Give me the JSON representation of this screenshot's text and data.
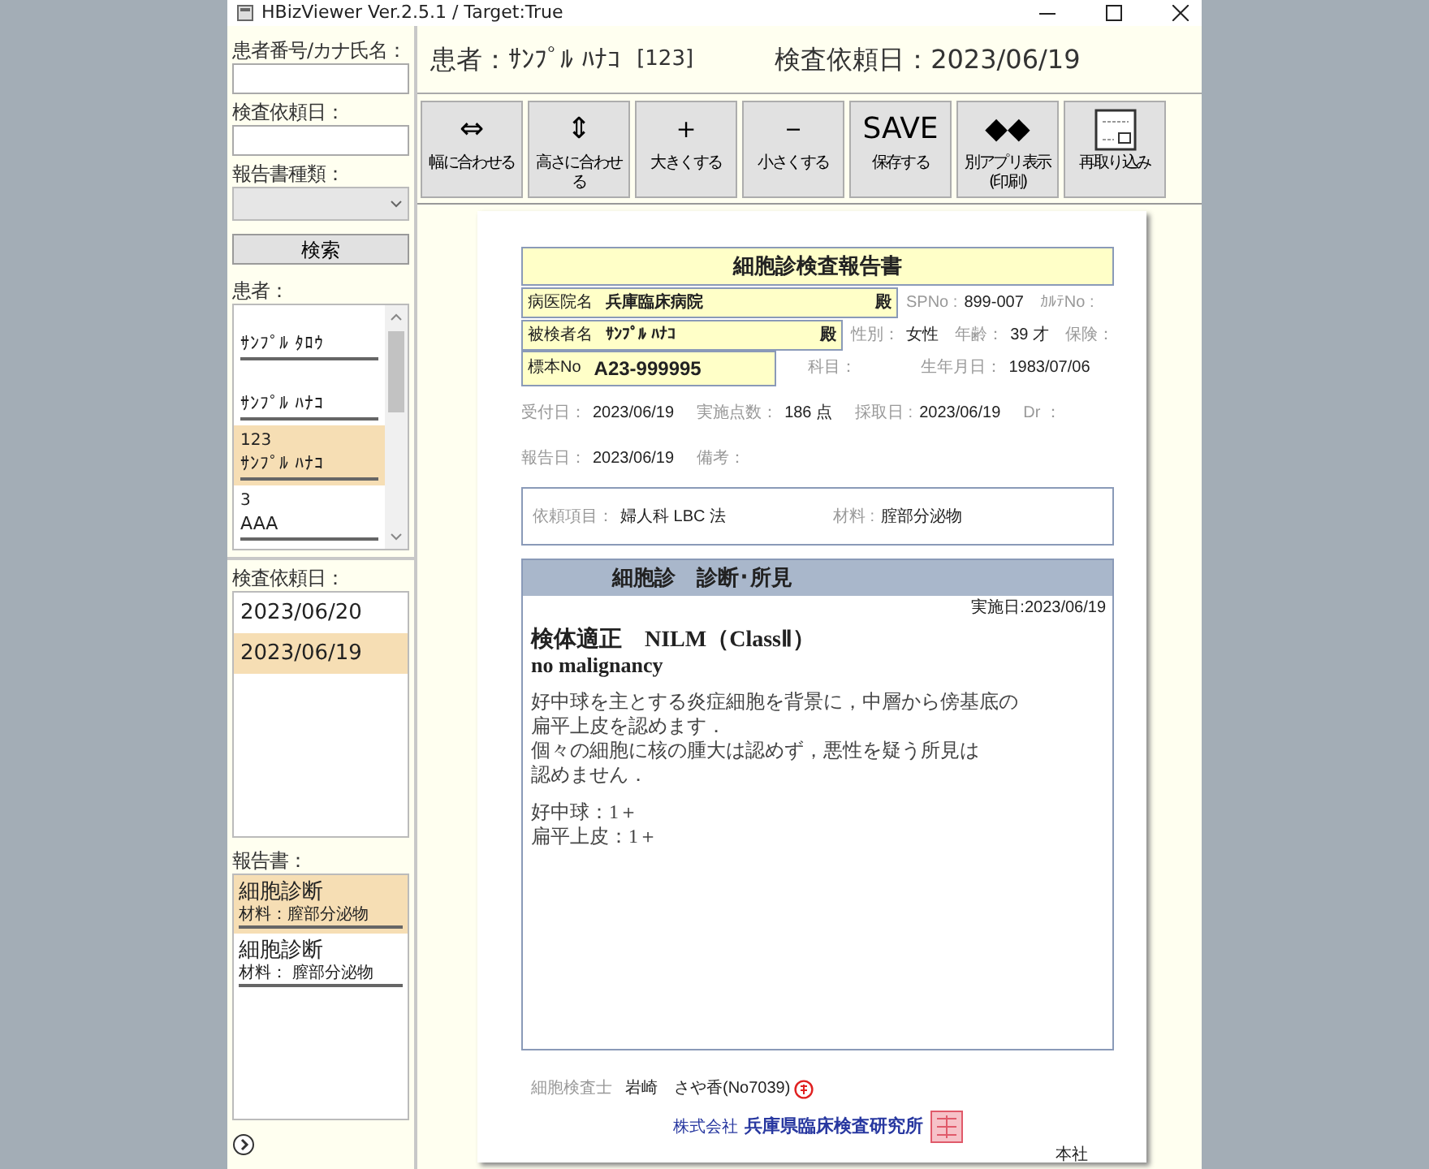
{
  "window": {
    "title": "HBizViewer Ver.2.5.1 / Target:True"
  },
  "sidebar": {
    "filters": [
      {
        "label": "患者番号/カナ氏名：",
        "kind": "text"
      },
      {
        "label": "検査依頼日：",
        "kind": "text"
      },
      {
        "label": "報告書種類：",
        "kind": "select"
      }
    ],
    "search_button": "検索",
    "patients": {
      "label": "患者：",
      "items": [
        {
          "name": "ｻﾝﾌﾟﾙ ﾀﾛｳ",
          "selected": false
        },
        {
          "name": "ｻﾝﾌﾟﾙ ﾊﾅｺ",
          "selected": false
        },
        {
          "id": "123",
          "name": "ｻﾝﾌﾟﾙ ﾊﾅｺ",
          "selected": true
        },
        {
          "id": "3",
          "name": "AAA",
          "selected": false
        }
      ]
    },
    "dates": {
      "label": "検査依頼日：",
      "items": [
        {
          "date": "2023/06/20",
          "selected": false
        },
        {
          "date": "2023/06/19",
          "selected": true
        }
      ]
    },
    "reports": {
      "label": "報告書：",
      "items": [
        {
          "title": "細胞診断",
          "material": "材料：膣部分泌物",
          "selected": true
        },
        {
          "title": "細胞診断",
          "material": "材料： 膣部分泌物",
          "selected": false
        }
      ]
    }
  },
  "header": {
    "patient": "患者：ｻﾝﾌﾟﾙ ﾊﾅｺ",
    "patient_id": "[123]",
    "request_date": "検査依頼日：2023/06/19"
  },
  "toolbar": [
    {
      "kind": "glyph",
      "glyph": "⇔",
      "label": "幅に合わせる"
    },
    {
      "kind": "glyph",
      "glyph": "⇕",
      "label": "高さに合わせる"
    },
    {
      "kind": "glyph",
      "glyph": "＋",
      "label": "大きくする"
    },
    {
      "kind": "glyph",
      "glyph": "－",
      "label": "小さくする"
    },
    {
      "kind": "glyph",
      "glyph": "SAVE",
      "label": "保存する"
    },
    {
      "kind": "glyph",
      "glyph": "◆◆",
      "label": "別アプリ表示\n(印刷)"
    },
    {
      "kind": "pdf",
      "label": "再取り込み"
    }
  ],
  "report": {
    "title": "細胞診検査報告書",
    "boxes": [
      {
        "label": "病医院名",
        "value": "兵庫臨床病院",
        "suffix": "殿",
        "side": [
          {
            "label": "SPNo :",
            "value": "899-007"
          },
          {
            "label": "ｶﾙﾃNo :"
          }
        ]
      },
      {
        "label": "被検者名",
        "value": "ｻﾝﾌﾟﾙ ﾊﾅｺ",
        "suffix": "殿",
        "side": [
          {
            "label": "性別：",
            "value": "女性"
          },
          {
            "label": "年齢：",
            "value": "39 才"
          },
          {
            "label": "保険："
          }
        ]
      },
      {
        "label": "標本No",
        "value": "A23-999995",
        "side": [
          {
            "label": "科目："
          },
          {
            "label": "生年月日：",
            "value": "1983/07/06"
          }
        ]
      }
    ],
    "info_rows": [
      [
        {
          "label": "受付日：",
          "value": "2023/06/19"
        },
        {
          "label": "実施点数：",
          "value": "186 点"
        },
        {
          "label": "採取日 :",
          "value": "2023/06/19"
        },
        {
          "label": "Dr ："
        }
      ],
      [
        {
          "label": "報告日：",
          "value": "2023/06/19"
        },
        {
          "label": "備考："
        }
      ]
    ],
    "request": [
      {
        "label": "依頼項目：",
        "value": "婦人科 LBC 法"
      },
      {
        "label": "材料 :",
        "value": "腟部分泌物"
      }
    ],
    "diagnosis": {
      "title": "細胞診　診断･所見",
      "date": "実施日:2023/06/19",
      "heading": "検体適正　NILM（ClassⅡ）",
      "subheading": "no malignancy",
      "paragraphs": [
        [
          "好中球を主とする炎症細胞を背景に，中層から傍基底の",
          "扁平上皮を認めます．",
          "個々の細胞に核の腫大は認めず，悪性を疑う所見は",
          "認めません．"
        ],
        [
          "好中球：1＋",
          "扁平上皮：1＋"
        ]
      ]
    },
    "signer": {
      "label": "細胞検査士",
      "name": "岩崎　さや香(No7039)"
    },
    "company": {
      "prefix": "株式会社",
      "name": "兵庫県臨床検査研究所"
    },
    "branch": "本社"
  }
}
